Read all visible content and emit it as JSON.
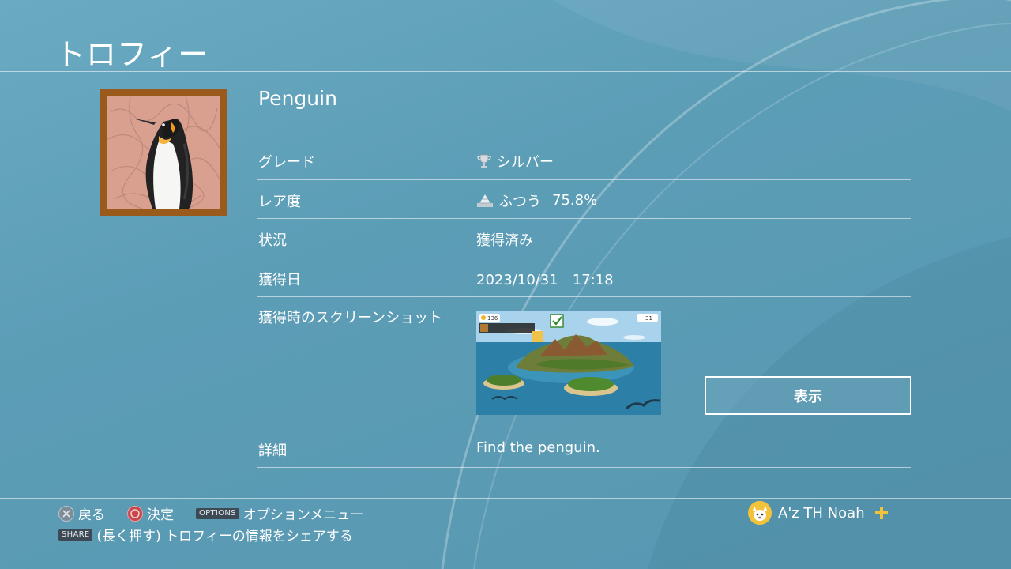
{
  "page": {
    "title": "トロフィー"
  },
  "trophy": {
    "name": "Penguin",
    "rows": {
      "grade": {
        "label": "グレード",
        "value": "シルバー"
      },
      "rarity": {
        "label": "レア度",
        "value": "ふつう",
        "percent": "75.8%"
      },
      "status": {
        "label": "状況",
        "value": "獲得済み"
      },
      "date": {
        "label": "獲得日",
        "value": "2023/10/31　17:18"
      },
      "screenshot": {
        "label": "獲得時のスクリーンショット",
        "button": "表示"
      },
      "detail": {
        "label": "詳細",
        "value": "Find the penguin."
      }
    }
  },
  "screenshot_hud": {
    "left_counter": "136",
    "right_counter": "31"
  },
  "footer": {
    "back": "戻る",
    "confirm": "決定",
    "options_key": "OPTIONS",
    "options": "オプションメニュー",
    "share_key": "SHARE",
    "share": "(長く押す) トロフィーの情報をシェアする"
  },
  "user": {
    "name": "A'z TH Noah"
  },
  "icons": {
    "grade": "silver-trophy-icon",
    "rarity": "rarity-pyramid-icon",
    "plus": "ps-plus-icon"
  },
  "colors": {
    "background": "#5fa0b8",
    "frame": "#9a5a1c",
    "plus": "#f2c23a"
  }
}
